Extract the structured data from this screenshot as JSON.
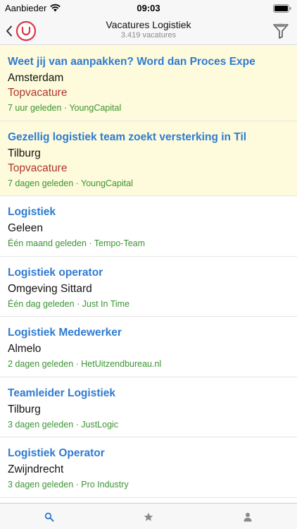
{
  "status_bar": {
    "carrier": "Aanbieder",
    "time": "09:03"
  },
  "header": {
    "title": "Vacatures Logistiek",
    "subtitle": "3.419 vacatures"
  },
  "jobs": [
    {
      "title": "Weet jij van aanpakken? Word dan Proces Expe",
      "location": "Amsterdam",
      "badge": "Topvacature",
      "meta": "7 uur geleden · YoungCapital",
      "featured": true
    },
    {
      "title": "Gezellig logistiek team zoekt versterking in Til",
      "location": "Tilburg",
      "badge": "Topvacature",
      "meta": "7 dagen geleden · YoungCapital",
      "featured": true
    },
    {
      "title": "Logistiek",
      "location": "Geleen",
      "meta": "Één maand geleden · Tempo-Team",
      "featured": false
    },
    {
      "title": "Logistiek operator",
      "location": "Omgeving Sittard",
      "meta": "Één dag geleden · Just In Time",
      "featured": false
    },
    {
      "title": "Logistiek Medewerker",
      "location": "Almelo",
      "meta": "2 dagen geleden · HetUitzendbureau.nl",
      "featured": false
    },
    {
      "title": "Teamleider Logistiek",
      "location": "Tilburg",
      "meta": "3 dagen geleden · JustLogic",
      "featured": false
    },
    {
      "title": "Logistiek Operator",
      "location": "Zwijndrecht",
      "meta": "3 dagen geleden · Pro Industry",
      "featured": false
    }
  ],
  "tabs": [
    {
      "icon": "search-icon",
      "active": true
    },
    {
      "icon": "star-icon",
      "active": false
    },
    {
      "icon": "person-icon",
      "active": false
    }
  ],
  "colors": {
    "title_blue": "#2f7bd1",
    "badge_red": "#b1362f",
    "meta_green": "#3b9433",
    "featured_bg": "#fdfbdb",
    "logo_red": "#d9394a"
  }
}
